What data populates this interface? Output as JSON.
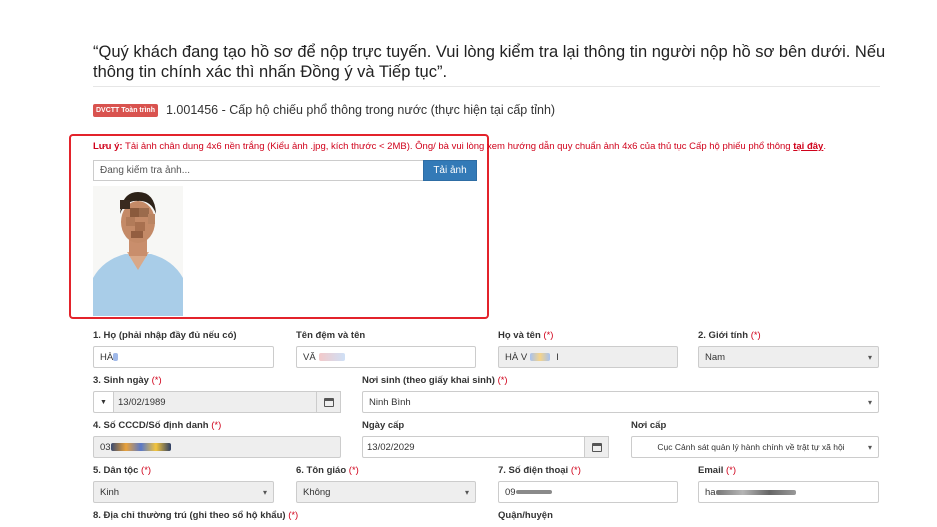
{
  "intro": "“Quý khách đang tạo hồ sơ để nộp trực tuyến. Vui lòng kiểm tra lại thông tin người nộp hồ sơ bên dưới. Nếu thông tin chính xác thì nhấn Đồng ý và Tiếp tục”.",
  "service": {
    "badge": "DVCTT Toàn trình",
    "title": "1.001456 - Cấp hộ chiếu phổ thông trong nước (thực hiện tại cấp tỉnh)"
  },
  "note": {
    "prefix": "Lưu ý:",
    "text": " Tải ảnh chân dung 4x6 nền trắng (Kiểu ảnh .jpg, kích thước < 2MB). Ông/ bà vui lòng xem hướng dẫn quy chuẩn ảnh 4x6 của thủ tục Cấp hộ phiếu phổ thông ",
    "link": "tại đây",
    "suffix": "."
  },
  "upload": {
    "placeholder": "Đang kiểm tra ảnh...",
    "button": "Tải ảnh"
  },
  "required_mark": "(*)",
  "fields": {
    "ho": {
      "label": "1. Họ (phải nhập đầy đủ nếu có)",
      "value": "HÀ"
    },
    "ten_dem": {
      "label": "Tên đệm và tên",
      "value": "VĂ"
    },
    "ho_va_ten": {
      "label": "Họ và tên",
      "value": "HÀ V",
      "value2": "I"
    },
    "gioi_tinh": {
      "label": "2. Giới tính",
      "value": "Nam"
    },
    "ngay_sinh": {
      "label": "3. Sinh ngày",
      "value": "13/02/1989"
    },
    "noi_sinh": {
      "label": "Nơi sinh (theo giấy khai sinh)",
      "value": "Ninh Bình"
    },
    "cccd": {
      "label": "4. Số CCCD/Số định danh",
      "value": "03"
    },
    "ngay_cap": {
      "label": "Ngày cấp",
      "value": "13/02/2029"
    },
    "noi_cap": {
      "label": "Nơi cấp",
      "value": "Cục Cảnh sát quản lý hành chính về trật tự xã hội"
    },
    "dan_toc": {
      "label": "5. Dân tộc",
      "value": "Kinh"
    },
    "ton_giao": {
      "label": "6. Tôn giáo",
      "value": "Không"
    },
    "sdt": {
      "label": "7. Số điện thoại",
      "value": "09"
    },
    "email": {
      "label": "Email",
      "value": "ha"
    },
    "dia_chi": {
      "label": "8. Địa chỉ thường trú (ghi theo sổ hộ khẩu)"
    },
    "quan_huyen": {
      "label": "Quận/huyện"
    }
  },
  "icons": {
    "select": "chevron-down-icon",
    "date": "calendar-icon",
    "stepper": "triangle-down-icon"
  }
}
